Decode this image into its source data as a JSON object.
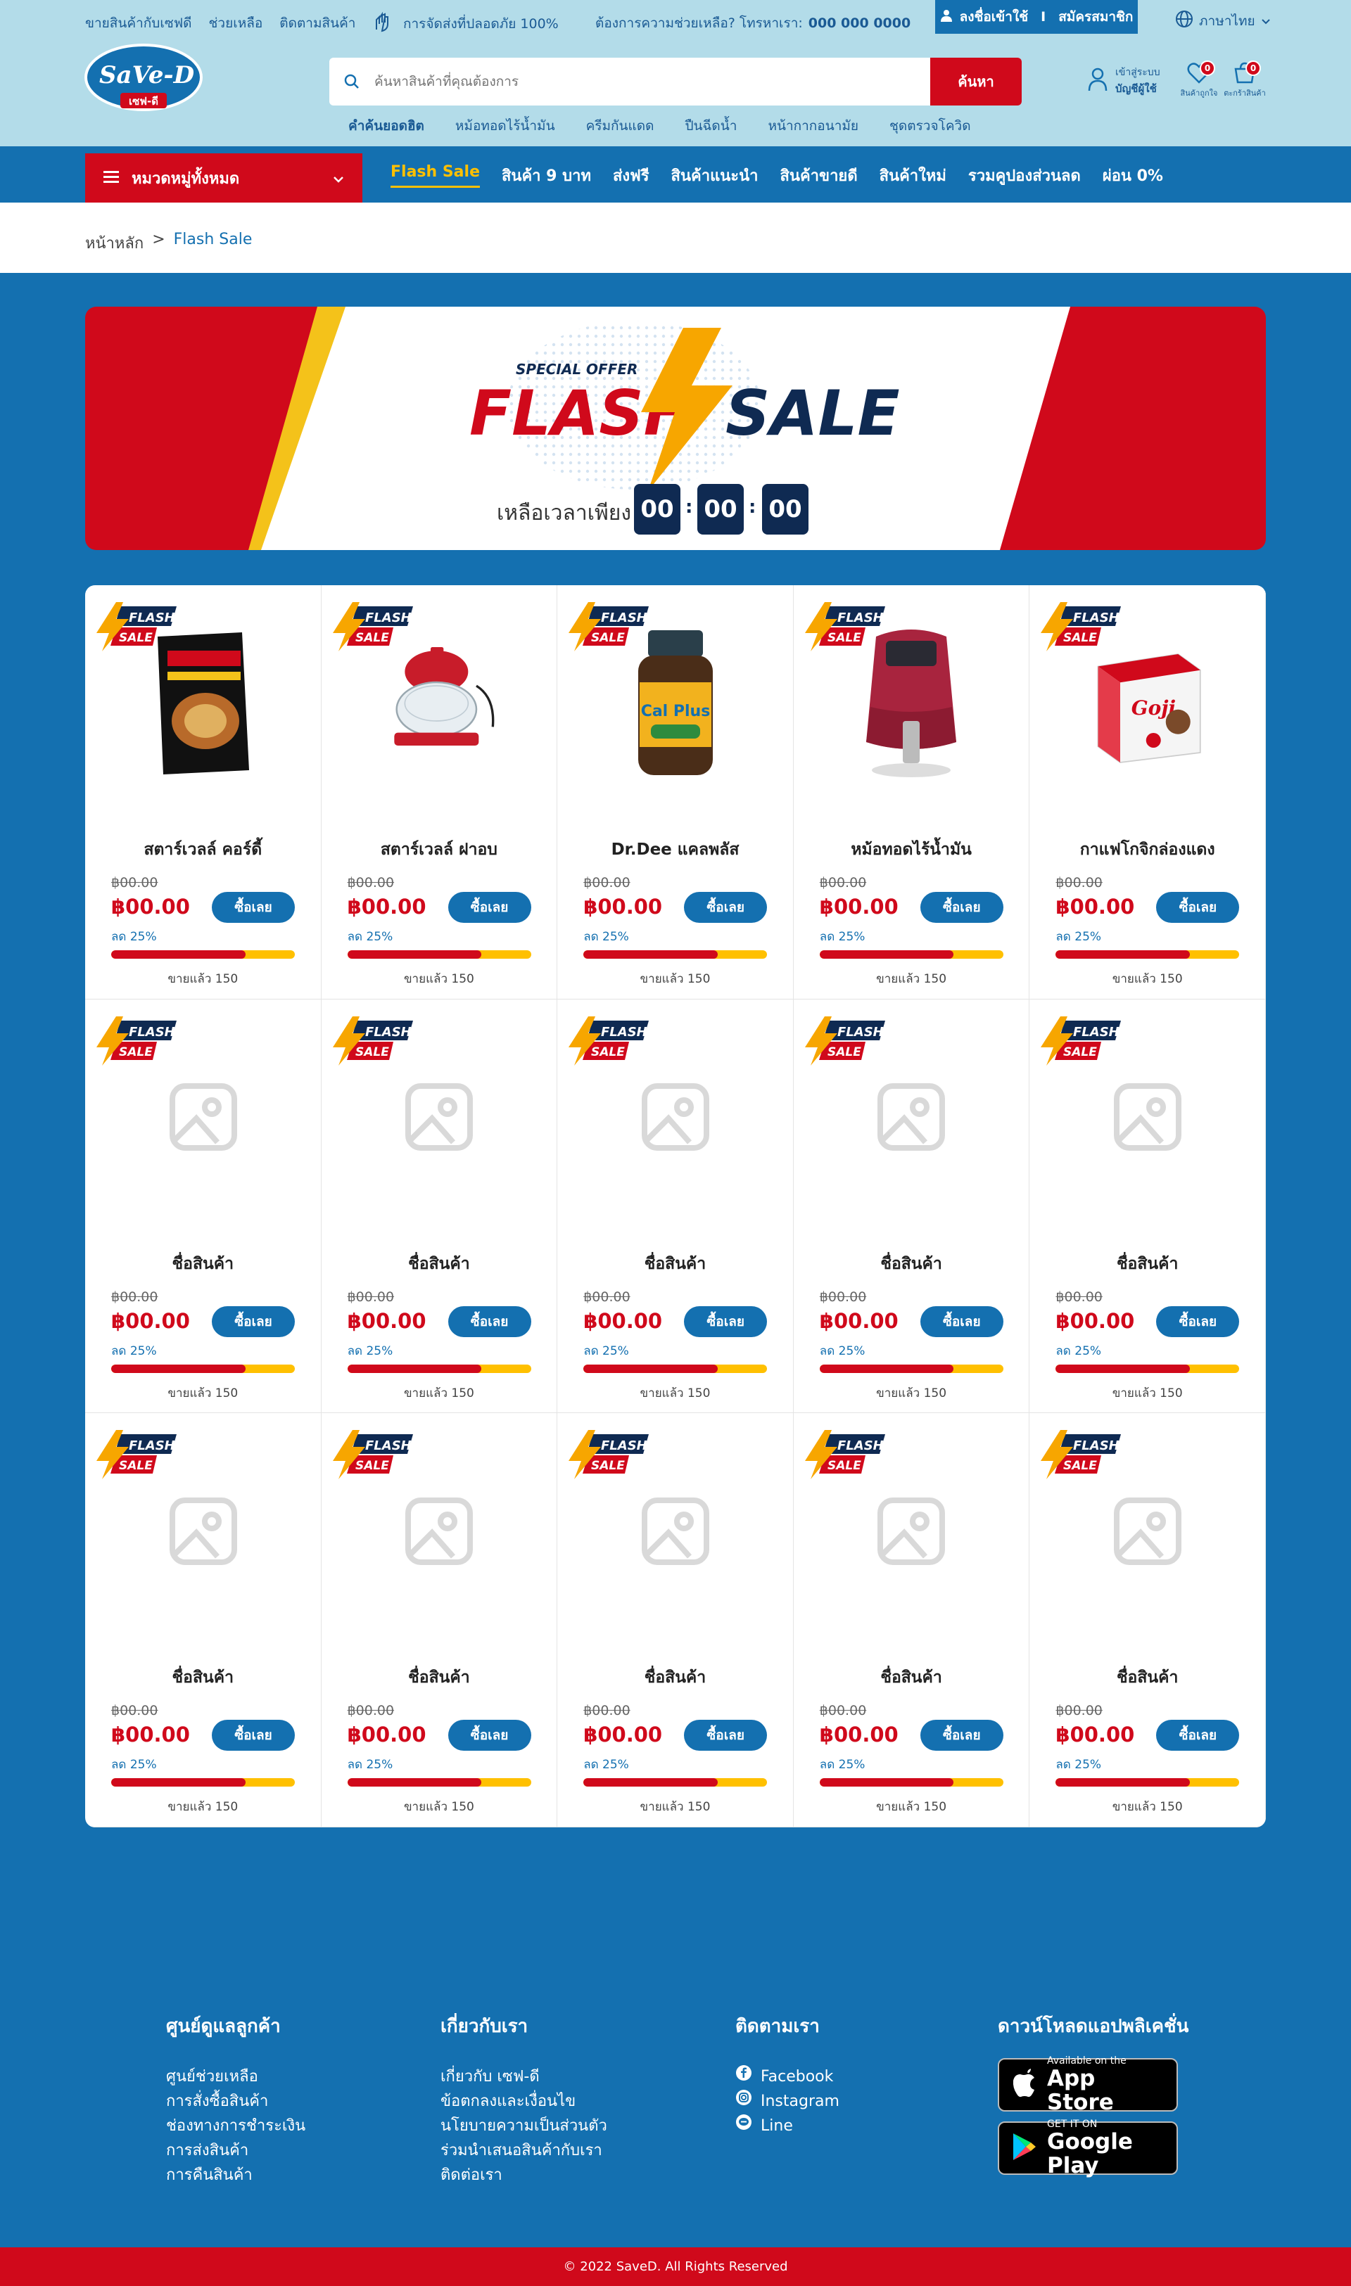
{
  "colors": {
    "brand_blue": "#1470b0",
    "brand_red": "#d0091b",
    "accent_yellow": "#ffc000",
    "navy": "#0f2a52",
    "top_strip": "#b3dce9"
  },
  "topbar": {
    "links": [
      "ขายสินค้ากับเซฟดี",
      "ช่วยเหลือ",
      "ติดตามสินค้า"
    ],
    "shipping_note": "การจัดส่งที่ปลอดภัย 100%",
    "help_text": "ต้องการความช่วยเหลือ? โทรหาเรา:",
    "help_phone": "000 000 0000",
    "login_label": "ลงชื่อเข้าใช้",
    "divider": "I",
    "register_label": "สมัครสมาชิก",
    "language": "ภาษาไทย"
  },
  "logo": {
    "brand": "SaVe-D",
    "sub": "เซฟ-ดี"
  },
  "search": {
    "placeholder": "ค้นหาสินค้าที่คุณต้องการ",
    "button": "ค้นหา",
    "hot_label": "คำค้นยอดฮิต",
    "hot_terms": [
      "หม้อทอดไร้น้ำมัน",
      "ครีมกันแดด",
      "ปืนฉีดน้ำ",
      "หน้ากากอนามัย",
      "ชุดตรวจโควิด"
    ]
  },
  "account": {
    "line1": "เข้าสู่ระบบ",
    "line2": "บัญชีผู้ใช้",
    "wishlist_label": "สินค้าถูกใจ",
    "wishlist_count": "0",
    "cart_label": "ตะกร้าสินค้า",
    "cart_count": "0"
  },
  "nav": {
    "category_button": "หมวดหมู่ทั้งหมด",
    "links": [
      "Flash Sale",
      "สินค้า 9 บาท",
      "ส่งฟรี",
      "สินค้าแนะนำ",
      "สินค้าขายดี",
      "สินค้าใหม่",
      "รวมคูปองส่วนลด",
      "ผ่อน 0%"
    ]
  },
  "breadcrumb": {
    "home": "หน้าหลัก",
    "sep": ">",
    "current": "Flash Sale"
  },
  "banner": {
    "special": "SPECIAL OFFER",
    "word1": "FLASH",
    "word2": "SALE",
    "timer_label": "เหลือเวลาเพียง",
    "hours": "00",
    "minutes": "00",
    "seconds": "00",
    "colon": ":"
  },
  "badge": {
    "line1": "FLASH",
    "line2": "SALE"
  },
  "products": [
    {
      "name": "สตาร์เวลล์ คอร์ดี้",
      "old_price": "฿00.00",
      "price": "฿00.00",
      "buy": "ซื้อเลย",
      "discount": "ลด 25%",
      "sold": "ขายแล้ว 150",
      "sold_fraction": 0.73,
      "image": "cordy-box"
    },
    {
      "name": "สตาร์เวลล์ ฝาอบ",
      "old_price": "฿00.00",
      "price": "฿00.00",
      "buy": "ซื้อเลย",
      "discount": "ลด 25%",
      "sold": "ขายแล้ว 150",
      "sold_fraction": 0.73,
      "image": "oven-lid"
    },
    {
      "name": "Dr.Dee แคลพลัส",
      "old_price": "฿00.00",
      "price": "฿00.00",
      "buy": "ซื้อเลย",
      "discount": "ลด 25%",
      "sold": "ขายแล้ว 150",
      "sold_fraction": 0.73,
      "image": "calplus-bottle",
      "bottle_label": "Cal Plus"
    },
    {
      "name": "หม้อทอดไร้น้ำมัน",
      "old_price": "฿00.00",
      "price": "฿00.00",
      "buy": "ซื้อเลย",
      "discount": "ลด 25%",
      "sold": "ขายแล้ว 150",
      "sold_fraction": 0.73,
      "image": "air-fryer"
    },
    {
      "name": "กาแฟโกจิกล่องแดง",
      "old_price": "฿00.00",
      "price": "฿00.00",
      "buy": "ซื้อเลย",
      "discount": "ลด 25%",
      "sold": "ขายแล้ว 150",
      "sold_fraction": 0.73,
      "image": "goji-box",
      "box_label": "Goji"
    },
    {
      "name": "ชื่อสินค้า",
      "old_price": "฿00.00",
      "price": "฿00.00",
      "buy": "ซื้อเลย",
      "discount": "ลด 25%",
      "sold": "ขายแล้ว 150",
      "sold_fraction": 0.73,
      "image": "placeholder"
    },
    {
      "name": "ชื่อสินค้า",
      "old_price": "฿00.00",
      "price": "฿00.00",
      "buy": "ซื้อเลย",
      "discount": "ลด 25%",
      "sold": "ขายแล้ว 150",
      "sold_fraction": 0.73,
      "image": "placeholder"
    },
    {
      "name": "ชื่อสินค้า",
      "old_price": "฿00.00",
      "price": "฿00.00",
      "buy": "ซื้อเลย",
      "discount": "ลด 25%",
      "sold": "ขายแล้ว 150",
      "sold_fraction": 0.73,
      "image": "placeholder"
    },
    {
      "name": "ชื่อสินค้า",
      "old_price": "฿00.00",
      "price": "฿00.00",
      "buy": "ซื้อเลย",
      "discount": "ลด 25%",
      "sold": "ขายแล้ว 150",
      "sold_fraction": 0.73,
      "image": "placeholder"
    },
    {
      "name": "ชื่อสินค้า",
      "old_price": "฿00.00",
      "price": "฿00.00",
      "buy": "ซื้อเลย",
      "discount": "ลด 25%",
      "sold": "ขายแล้ว 150",
      "sold_fraction": 0.73,
      "image": "placeholder"
    },
    {
      "name": "ชื่อสินค้า",
      "old_price": "฿00.00",
      "price": "฿00.00",
      "buy": "ซื้อเลย",
      "discount": "ลด 25%",
      "sold": "ขายแล้ว 150",
      "sold_fraction": 0.73,
      "image": "placeholder"
    },
    {
      "name": "ชื่อสินค้า",
      "old_price": "฿00.00",
      "price": "฿00.00",
      "buy": "ซื้อเลย",
      "discount": "ลด 25%",
      "sold": "ขายแล้ว 150",
      "sold_fraction": 0.73,
      "image": "placeholder"
    },
    {
      "name": "ชื่อสินค้า",
      "old_price": "฿00.00",
      "price": "฿00.00",
      "buy": "ซื้อเลย",
      "discount": "ลด 25%",
      "sold": "ขายแล้ว 150",
      "sold_fraction": 0.73,
      "image": "placeholder"
    },
    {
      "name": "ชื่อสินค้า",
      "old_price": "฿00.00",
      "price": "฿00.00",
      "buy": "ซื้อเลย",
      "discount": "ลด 25%",
      "sold": "ขายแล้ว 150",
      "sold_fraction": 0.73,
      "image": "placeholder"
    },
    {
      "name": "ชื่อสินค้า",
      "old_price": "฿00.00",
      "price": "฿00.00",
      "buy": "ซื้อเลย",
      "discount": "ลด 25%",
      "sold": "ขายแล้ว 150",
      "sold_fraction": 0.73,
      "image": "placeholder"
    }
  ],
  "footer": {
    "customer": {
      "title": "ศูนย์ดูแลลูกค้า",
      "links": [
        "ศูนย์ช่วยเหลือ",
        "การสั่งซื้อสินค้า",
        "ช่องทางการชำระเงิน",
        "การส่งสินค้า",
        "การคืนสินค้า"
      ]
    },
    "about": {
      "title": "เกี่ยวกับเรา",
      "links": [
        "เกี่ยวกับ เซฟ-ดี",
        "ข้อตกลงและเงื่อนไข",
        "นโยบายความเป็นส่วนตัว",
        "ร่วมนำเสนอสินค้ากับเรา",
        "ติดต่อเรา"
      ]
    },
    "follow": {
      "title": "ติดตามเรา",
      "links": [
        "Facebook",
        "Instagram",
        "Line"
      ]
    },
    "app": {
      "title": "ดาวน์โหลดแอปพลิเคชั่น",
      "apple_line1": "Available on the",
      "apple_line2": "App Store",
      "google_line1": "GET IT ON",
      "google_line2": "Google Play"
    },
    "copyright": "© 2022 SaveD. All Rights Reserved"
  }
}
